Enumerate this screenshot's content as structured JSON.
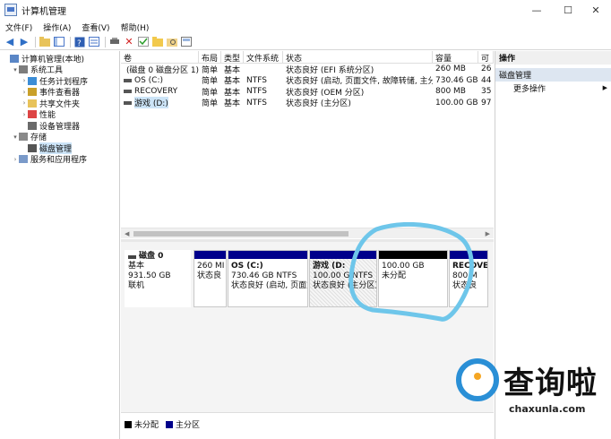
{
  "window": {
    "title": "计算机管理",
    "minimize_glyph": "—",
    "maximize_glyph": "☐",
    "close_glyph": "✕"
  },
  "menu": [
    "文件(F)",
    "操作(A)",
    "查看(V)",
    "帮助(H)"
  ],
  "tree": [
    {
      "label": "计算机管理(本地)",
      "indent": 0,
      "expander": "",
      "icon": "computer-icon"
    },
    {
      "label": "系统工具",
      "indent": 1,
      "expander": "▾",
      "icon": "tools-icon"
    },
    {
      "label": "任务计划程序",
      "indent": 2,
      "expander": "›",
      "icon": "clock-icon"
    },
    {
      "label": "事件查看器",
      "indent": 2,
      "expander": "›",
      "icon": "event-icon"
    },
    {
      "label": "共享文件夹",
      "indent": 2,
      "expander": "›",
      "icon": "folder-icon"
    },
    {
      "label": "性能",
      "indent": 2,
      "expander": "›",
      "icon": "performance-icon"
    },
    {
      "label": "设备管理器",
      "indent": 2,
      "expander": "",
      "icon": "device-icon"
    },
    {
      "label": "存储",
      "indent": 1,
      "expander": "▾",
      "icon": "storage-icon"
    },
    {
      "label": "磁盘管理",
      "indent": 2,
      "expander": "",
      "icon": "disk-icon",
      "selected": true
    },
    {
      "label": "服务和应用程序",
      "indent": 1,
      "expander": "›",
      "icon": "services-icon"
    }
  ],
  "volume_table": {
    "headers": [
      "卷",
      "布局",
      "类型",
      "文件系统",
      "状态",
      "容量",
      "可"
    ],
    "rows": [
      {
        "vol": "(磁盘 0 磁盘分区 1)",
        "layout": "简单",
        "type": "基本",
        "fs": "",
        "status": "状态良好 (EFI 系统分区)",
        "capacity": "260 MB",
        "free": "26"
      },
      {
        "vol": "OS (C:)",
        "layout": "简单",
        "type": "基本",
        "fs": "NTFS",
        "status": "状态良好 (启动, 页面文件, 故障转储, 主分区)",
        "capacity": "730.46 GB",
        "free": "44"
      },
      {
        "vol": "RECOVERY",
        "layout": "简单",
        "type": "基本",
        "fs": "NTFS",
        "status": "状态良好 (OEM 分区)",
        "capacity": "800 MB",
        "free": "35"
      },
      {
        "vol": "游戏 (D:)",
        "layout": "简单",
        "type": "基本",
        "fs": "NTFS",
        "status": "状态良好 (主分区)",
        "capacity": "100.00 GB",
        "free": "97",
        "selected": true
      }
    ]
  },
  "disk": {
    "name": "磁盘 0",
    "type": "基本",
    "size": "931.50 GB",
    "state": "联机",
    "partitions": [
      {
        "title": "",
        "line1": "260 MI",
        "line2": "状态良",
        "kind": "primary"
      },
      {
        "title": "OS (C:)",
        "line1": "730.46 GB NTFS",
        "line2": "状态良好 (启动, 页面文",
        "kind": "primary"
      },
      {
        "title": "游戏 (D:",
        "line1": "100.00 G NTFS",
        "line2": "状态良好 (主分区)",
        "kind": "primary",
        "selected": true
      },
      {
        "title": "",
        "line1": "100.00 GB",
        "line2": "未分配",
        "kind": "unallocated"
      },
      {
        "title": "RECOVEI",
        "line1": "800 M",
        "line2": "状态良",
        "kind": "primary"
      }
    ]
  },
  "legend": [
    {
      "label": "未分配",
      "color": "#000000"
    },
    {
      "label": "主分区",
      "color": "#00008b"
    }
  ],
  "actions": {
    "header": "操作",
    "section": "磁盘管理",
    "more": "更多操作"
  },
  "colors": {
    "primary_partition": "#00008b",
    "unallocated": "#000000",
    "annotation": "#6ec6ea",
    "selection": "#cce4f7"
  },
  "watermark": {
    "text": "查询啦",
    "url": "chaxunla.com"
  }
}
